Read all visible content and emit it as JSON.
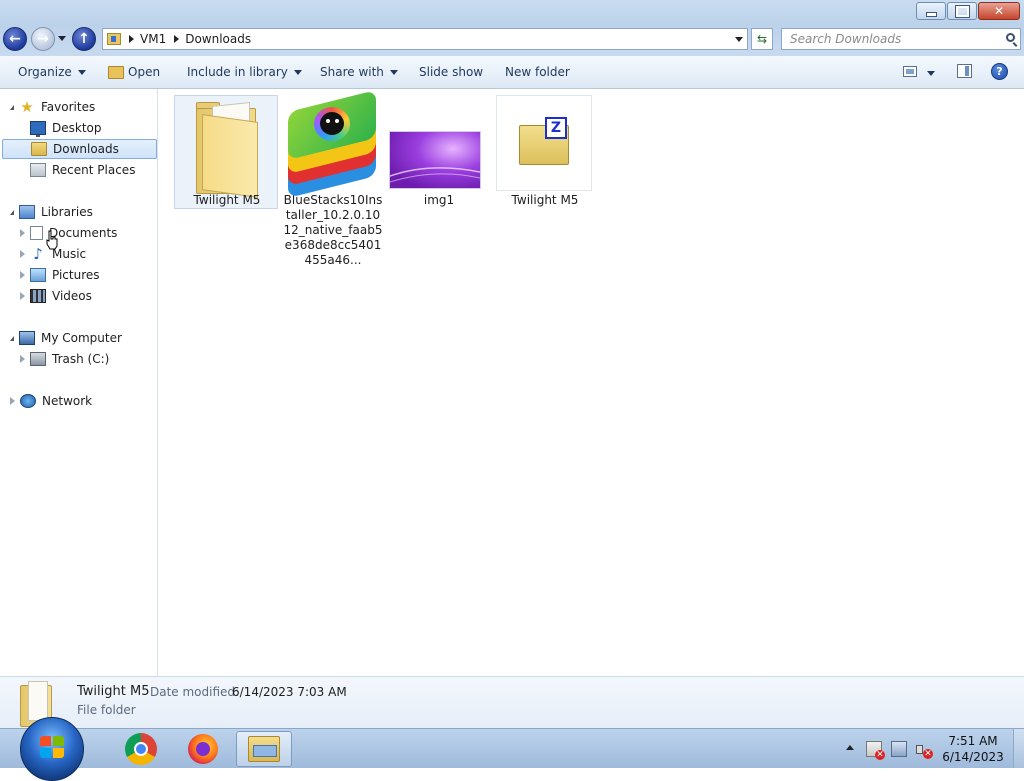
{
  "window": {
    "minimize_label": "—",
    "restore_label": "❐",
    "close_label": "✕"
  },
  "nav": {
    "breadcrumb": [
      "VM1",
      "Downloads"
    ],
    "search_placeholder": "Search Downloads"
  },
  "toolbar": {
    "organize": "Organize",
    "open": "Open",
    "include_in_library": "Include in library",
    "share_with": "Share with",
    "slide_show": "Slide show",
    "new_folder": "New folder",
    "help": "?"
  },
  "sidebar": {
    "favorites": {
      "label": "Favorites",
      "items": [
        "Desktop",
        "Downloads",
        "Recent Places"
      ]
    },
    "libraries": {
      "label": "Libraries",
      "items": [
        "Documents",
        "Music",
        "Pictures",
        "Videos"
      ]
    },
    "computer": {
      "label": "My Computer",
      "items": [
        "Trash (C:)"
      ]
    },
    "network": {
      "label": "Network"
    },
    "selected": "Downloads"
  },
  "files": [
    {
      "name": "Twilight M5",
      "kind": "folder",
      "selected": true
    },
    {
      "name": "BlueStacks10Installer_10.2.0.1012_native_faab5e368de8cc5401455a46...",
      "kind": "bluestacks-installer"
    },
    {
      "name": "img1",
      "kind": "image"
    },
    {
      "name": "Twilight M5",
      "kind": "zip-archive"
    }
  ],
  "details": {
    "name": "Twilight M5",
    "date_modified_label": "Date modified:",
    "date_modified": "6/14/2023 7:03 AM",
    "type": "File folder"
  },
  "taskbar": {
    "apps": [
      "chrome",
      "firefox",
      "windows-explorer"
    ],
    "active_app": "windows-explorer",
    "time": "7:51 AM",
    "date": "6/14/2023"
  },
  "colors": {
    "chrome_blue": "#bcd2ea",
    "selection": "#cfe3fa",
    "text_link": "#1e395b"
  }
}
